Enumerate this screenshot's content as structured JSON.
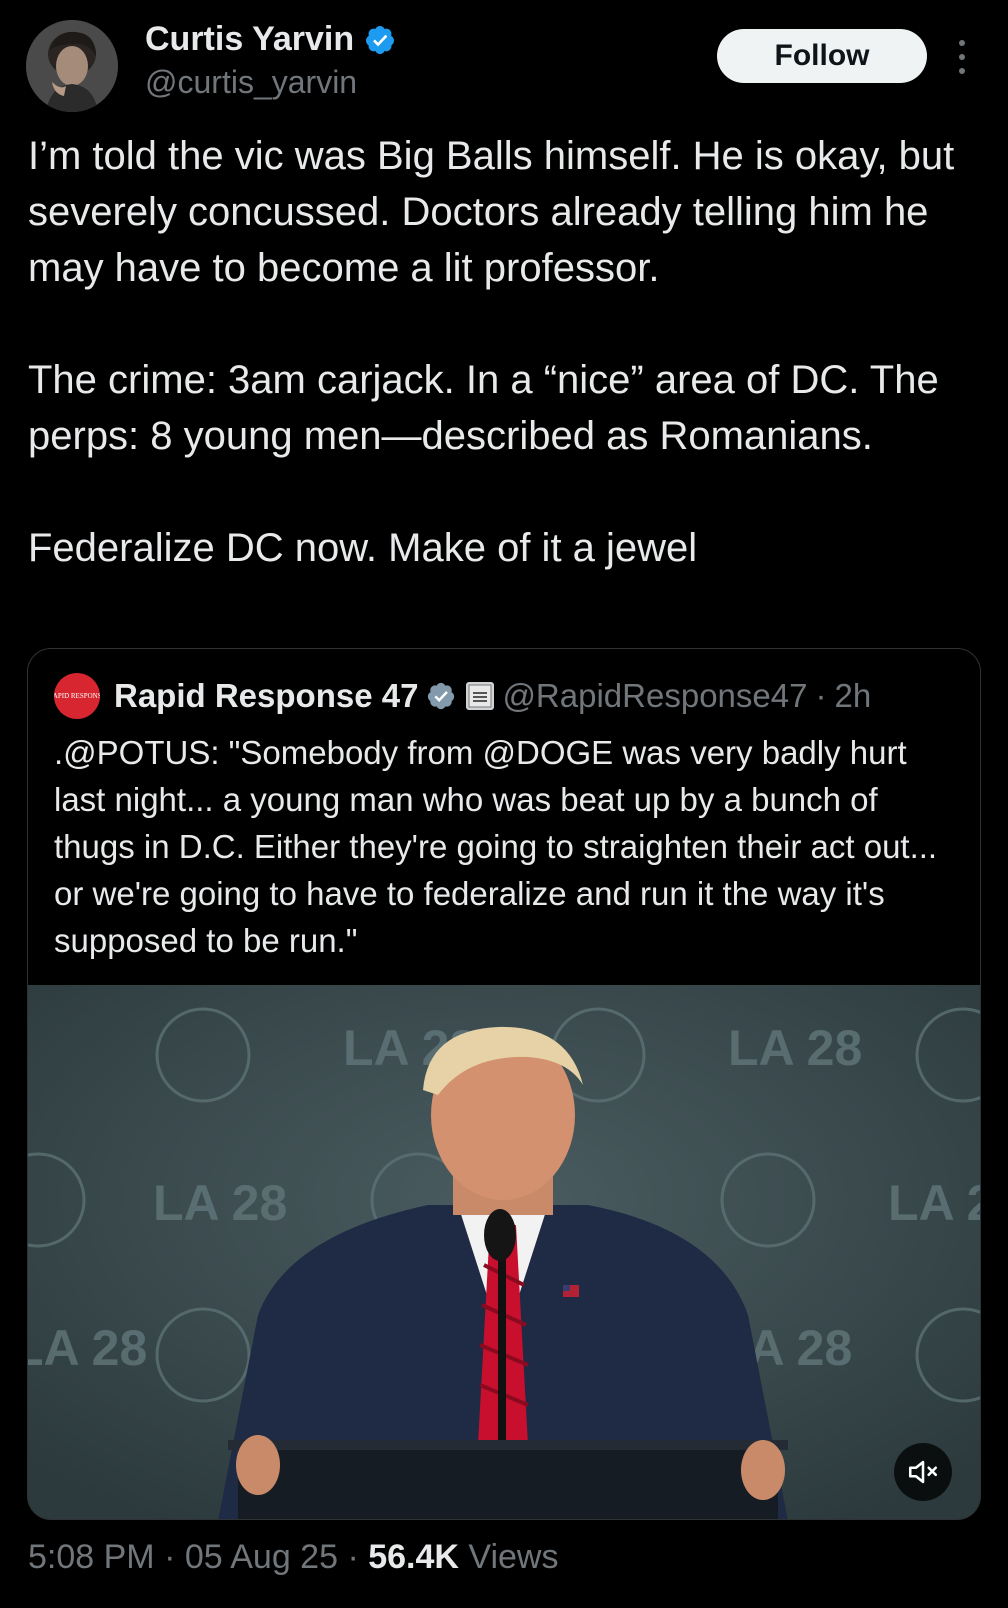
{
  "author": {
    "display_name": "Curtis Yarvin",
    "handle": "@curtis_yarvin",
    "verified": true,
    "avatar_icon": "profile-photo"
  },
  "actions": {
    "follow_label": "Follow",
    "more_icon": "more-vertical-icon"
  },
  "tweet": {
    "paragraphs": [
      "I’m told the vic was Big Balls himself. He is okay, but severely concussed. Doctors already telling him he may have to become a lit professor.",
      "The crime: 3am carjack. In a “nice” area of DC. The perps: 8 young men—described as Romanians.",
      "Federalize DC now. Make of it a jewel"
    ]
  },
  "quote": {
    "avatar_label": "RAPID RESPONSE",
    "display_name": "Rapid Response 47",
    "handle": "@RapidResponse47",
    "separator": "·",
    "time": "2h",
    "text": ".@POTUS: \"Somebody from @DOGE was very badly hurt last night... a young man who was beat up by a bunch of thugs in D.C. Either they're going to straighten their act out... or we're going to have to federalize and run it the way it's supposed to be run.\"",
    "media": {
      "backdrop_text": "LA 28",
      "mute_icon": "muted-speaker-icon"
    }
  },
  "meta": {
    "time": "5:08 PM",
    "sep1": " · ",
    "date": "05 Aug 25",
    "sep2": " · ",
    "views_count": "56.4K",
    "views_label": " Views"
  },
  "colors": {
    "background": "#000000",
    "text_primary": "#e7e9ea",
    "text_secondary": "#71767b",
    "verified_blue": "#1d9bf0",
    "border": "#2f3336",
    "rr_red": "#d7262f"
  }
}
